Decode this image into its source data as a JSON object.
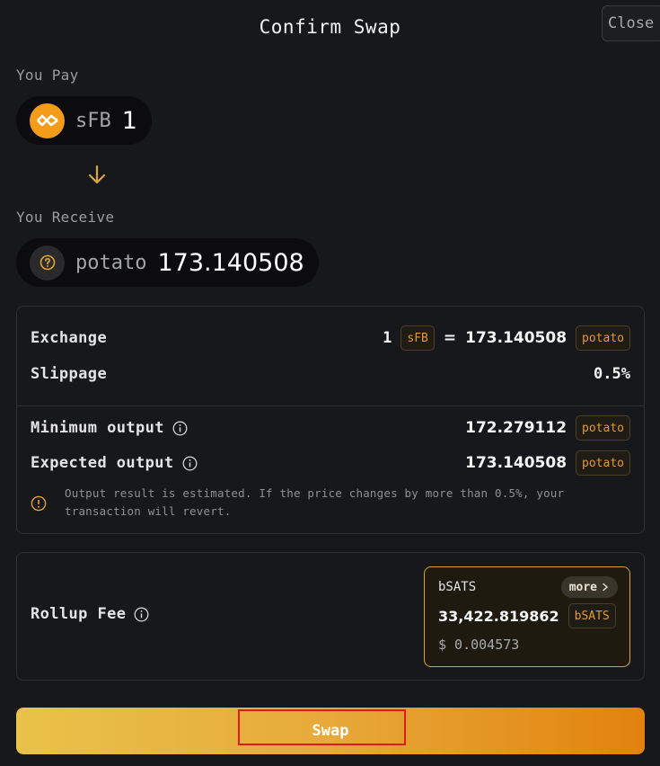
{
  "header": {
    "title": "Confirm Swap",
    "close_label": "Close"
  },
  "pay": {
    "label": "You Pay",
    "token_symbol": "sFB",
    "amount": "1",
    "icon": "sfb-token-icon"
  },
  "receive": {
    "label": "You Receive",
    "token_symbol": "potato",
    "amount": "173.140508",
    "icon": "unknown-token-icon"
  },
  "details": {
    "exchange": {
      "label": "Exchange",
      "from_amount": "1",
      "from_token": "sFB",
      "equals": "=",
      "to_amount": "173.140508",
      "to_token": "potato"
    },
    "slippage": {
      "label": "Slippage",
      "value": "0.5%"
    },
    "minimum_output": {
      "label": "Minimum output",
      "value": "172.279112",
      "token": "potato"
    },
    "expected_output": {
      "label": "Expected output",
      "value": "173.140508",
      "token": "potato"
    },
    "notice": "Output result is estimated. If the price changes by more than 0.5%, your transaction will revert."
  },
  "fee": {
    "label": "Rollup Fee",
    "token": "bSATS",
    "more_label": "more",
    "amount": "33,422.819862",
    "amount_token": "bSATS",
    "usd": "$ 0.004573"
  },
  "actions": {
    "swap_label": "Swap"
  },
  "colors": {
    "accent": "#e39a2e",
    "background": "#17181b",
    "swap_gradient_start": "#e9c24a",
    "swap_gradient_end": "#e2820e",
    "highlight_border": "#e01b1b"
  }
}
